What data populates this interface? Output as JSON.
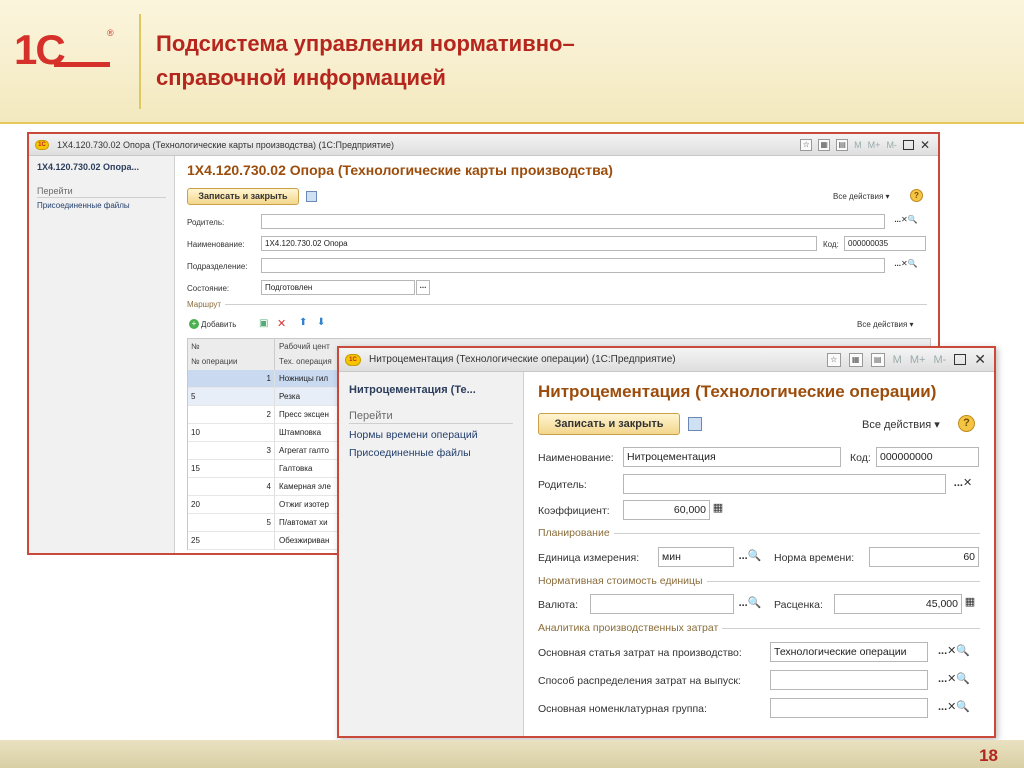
{
  "slide": {
    "logo_text": "1С",
    "logo_reg": "®",
    "title_line1": "Подсистема управления нормативно–",
    "title_line2": "справочной информацией",
    "page_number": "18"
  },
  "back_window": {
    "title": "1Х4.120.730.02 Опора (Технологические карты производства)  (1С:Предприятие)",
    "sidebar": {
      "title": "1Х4.120.730.02 Опора...",
      "section": "Перейти",
      "links": [
        "Присоединенные файлы"
      ]
    },
    "form_title": "1Х4.120.730.02 Опора (Технологические карты производства)",
    "save_close": "Записать и закрыть",
    "all_actions": "Все действия ▾",
    "fields": {
      "parent_label": "Родитель:",
      "name_label": "Наименование:",
      "name_value": "1Х4.120.730.02 Опора",
      "code_label": "Код:",
      "code_value": "000000035",
      "division_label": "Подразделение:",
      "state_label": "Состояние:",
      "state_value": "Подготовлен"
    },
    "route_section": "Маршрут",
    "add_button": "Добавить",
    "table_all_actions": "Все действия ▾",
    "table": {
      "col1_head1": "№",
      "col1_head2": "№ операции",
      "col2_head1": "Рабочий цент",
      "col2_head2": "Тех. операция",
      "rows": [
        {
          "n": "1",
          "op": "",
          "text": "Ножницы гил"
        },
        {
          "n": "",
          "op": "5",
          "text": "Резка"
        },
        {
          "n": "2",
          "op": "",
          "text": "Пресс эксцен"
        },
        {
          "n": "",
          "op": "10",
          "text": "Штамповка"
        },
        {
          "n": "3",
          "op": "",
          "text": "Агрегат галто"
        },
        {
          "n": "",
          "op": "15",
          "text": "Галтовка"
        },
        {
          "n": "4",
          "op": "",
          "text": "Камерная эле"
        },
        {
          "n": "",
          "op": "20",
          "text": "Отжиг изотер"
        },
        {
          "n": "5",
          "op": "",
          "text": "П/автомат хи"
        },
        {
          "n": "",
          "op": "25",
          "text": "Обезжириван"
        }
      ]
    }
  },
  "front_window": {
    "title": "Нитроцементация (Технологические операции)  (1С:Предприятие)",
    "sidebar": {
      "title": "Нитроцементация (Те...",
      "section": "Перейти",
      "links": [
        "Нормы времени операций",
        "Присоединенные файлы"
      ]
    },
    "form_title": "Нитроцементация (Технологические операции)",
    "save_close": "Записать и закрыть",
    "all_actions": "Все действия ▾",
    "name_label": "Наименование:",
    "name_value": "Нитроцементация",
    "code_label": "Код:",
    "code_value": "000000000",
    "parent_label": "Родитель:",
    "coef_label": "Коэффициент:",
    "coef_value": "60,000",
    "planning_section": "Планирование",
    "unit_label": "Единица измерения:",
    "unit_value": "мин",
    "norm_label": "Норма времени:",
    "norm_value": "60",
    "cost_section": "Нормативная стоимость единицы",
    "currency_label": "Валюта:",
    "rate_label": "Расценка:",
    "rate_value": "45,000",
    "analytics_section": "Аналитика производственных затрат",
    "cost_item_label": "Основная статья затрат на производство:",
    "cost_item_value": "Технологические операции",
    "distribution_label": "Способ распределения затрат на выпуск:",
    "nomenclature_label": "Основная номенклатурная группа:"
  },
  "colors": {
    "title_red": "#b5261e",
    "window_border": "#c94a3a",
    "form_title": "#9c4d0c",
    "button_yellow": "#f3d68c"
  }
}
